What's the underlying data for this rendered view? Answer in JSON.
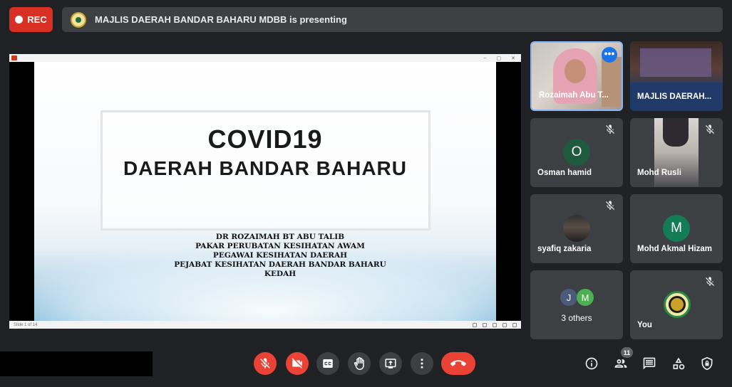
{
  "recording": {
    "label": "REC"
  },
  "banner": {
    "text": "MAJLIS DAERAH BANDAR BAHARU MDBB is presenting"
  },
  "presentation": {
    "window_title": "",
    "title_line1": "COVID19",
    "title_line2": "DAERAH BANDAR BAHARU",
    "author_lines": [
      "DR ROZAIMAH BT ABU TALIB",
      "PAKAR PERUBATAN KESIHATAN AWAM",
      "PEGAWAI KESIHATAN DAERAH",
      "PEJABAT KESIHATAN DAERAH BANDAR BAHARU",
      "KEDAH"
    ],
    "slide_status": "Slide 1 of 14"
  },
  "participants": [
    {
      "name": "Rozaimah Abu T...",
      "type": "video",
      "muted": false
    },
    {
      "name": "MAJLIS DAERAH...",
      "type": "video",
      "muted": false
    },
    {
      "name": "Osman hamid",
      "initial": "O",
      "color": "#1e5a3e",
      "muted": true
    },
    {
      "name": "Mohd Rusli",
      "type": "video",
      "muted": true
    },
    {
      "name": "syafiq zakaria",
      "type": "photo",
      "muted": true
    },
    {
      "name": "Mohd Akmal Hizam",
      "initial": "M",
      "color": "#137c56",
      "muted": false
    },
    {
      "name": "3 others",
      "initials": [
        "J",
        "M"
      ],
      "colors": [
        "#4a5a78",
        "#4caf50"
      ]
    },
    {
      "name": "You",
      "type": "logo",
      "muted": true
    }
  ],
  "participant_count": "11",
  "icons": {
    "mic": "mic-off-icon",
    "camera": "camera-off-icon",
    "captions": "captions-icon",
    "hand": "raise-hand-icon",
    "present": "present-icon",
    "more": "more-options-icon",
    "hangup": "hang-up-icon",
    "info": "info-icon",
    "people": "people-icon",
    "chat": "chat-icon",
    "activities": "activities-icon",
    "host": "host-controls-icon"
  },
  "colors": {
    "background": "#202124",
    "tile": "#3c4043",
    "danger": "#ea4335",
    "accent": "#8ab4f8"
  }
}
